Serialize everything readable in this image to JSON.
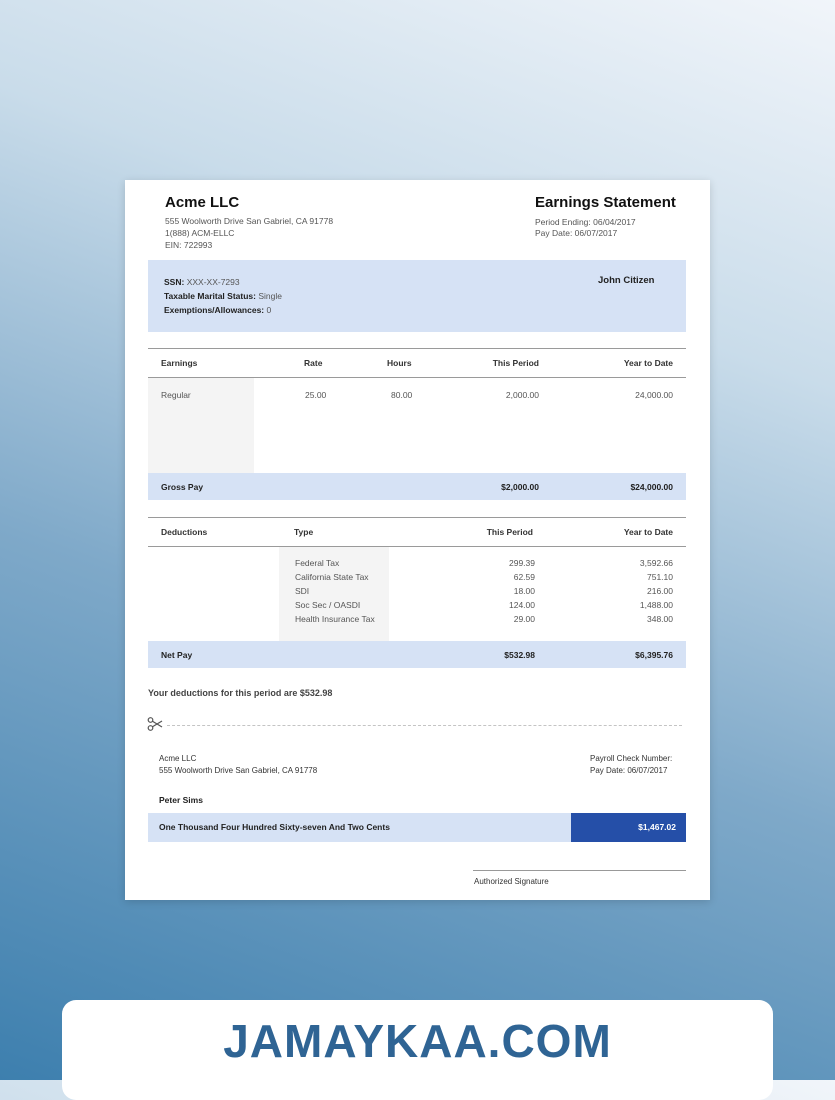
{
  "company": {
    "name": "Acme LLC",
    "address": "555 Woolworth Drive San Gabriel, CA 91778",
    "phone": "1(888) ACM-ELLC",
    "ein": "EIN: 722993"
  },
  "statement": {
    "title": "Earnings Statement",
    "period_ending": "Period Ending: 06/04/2017",
    "pay_date": "Pay Date: 06/07/2017"
  },
  "employee": {
    "ssn_label": "SSN:",
    "ssn": "XXX-XX-7293",
    "marital_label": "Taxable Marital Status:",
    "marital": "Single",
    "exemptions_label": "Exemptions/Allowances:",
    "exemptions": "0",
    "name": "John Citizen"
  },
  "earnings": {
    "headers": [
      "Earnings",
      "Rate",
      "Hours",
      "This Period",
      "Year to Date"
    ],
    "rows": [
      {
        "name": "Regular",
        "rate": "25.00",
        "hours": "80.00",
        "period": "2,000.00",
        "ytd": "24,000.00"
      }
    ],
    "gross_label": "Gross Pay",
    "gross_period": "$2,000.00",
    "gross_ytd": "$24,000.00"
  },
  "deductions": {
    "headers": [
      "Deductions",
      "Type",
      "This Period",
      "Year to Date"
    ],
    "rows": [
      {
        "type": "Federal Tax",
        "period": "299.39",
        "ytd": "3,592.66"
      },
      {
        "type": "California State Tax",
        "period": "62.59",
        "ytd": "751.10"
      },
      {
        "type": "SDI",
        "period": "18.00",
        "ytd": "216.00"
      },
      {
        "type": "Soc Sec / OASDI",
        "period": "124.00",
        "ytd": "1,488.00"
      },
      {
        "type": "Health Insurance Tax",
        "period": "29.00",
        "ytd": "348.00"
      }
    ],
    "net_label": "Net Pay",
    "net_period": "$532.98",
    "net_ytd": "$6,395.76",
    "summary": "Your deductions for this period are $532.98"
  },
  "check": {
    "company": "Acme LLC",
    "address": "555 Woolworth Drive San Gabriel, CA 91778",
    "check_number_label": "Payroll Check Number:",
    "pay_date": "Pay Date: 06/07/2017",
    "payee": "Peter Sims",
    "amount_words": "One Thousand Four Hundred Sixty-seven And Two Cents",
    "amount": "$1,467.02",
    "signature_label": "Authorized Signature"
  },
  "watermark": "JAMAYKAA.COM",
  "icons": {
    "scissors": "scissors-icon"
  },
  "colors": {
    "band": "#d6e2f5",
    "amount_box": "#254fa8",
    "brand": "#2f6494"
  }
}
